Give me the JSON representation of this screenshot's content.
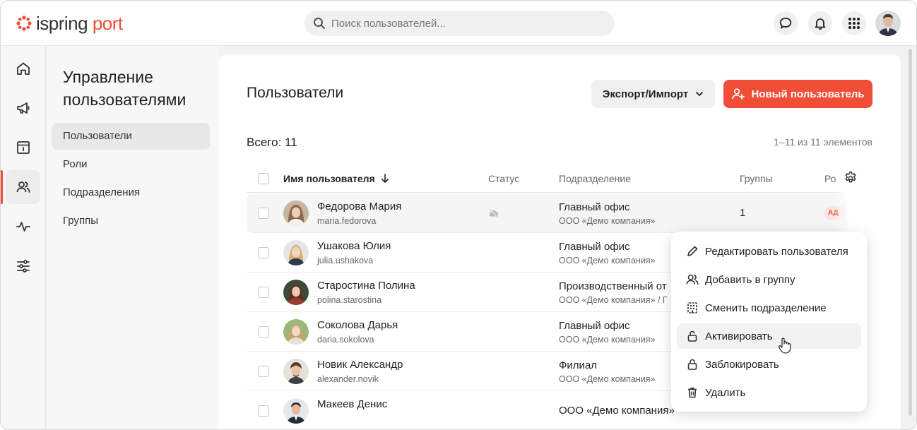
{
  "brand": {
    "logo_part1": "ispring",
    "logo_part2": "port",
    "accent": "#f04e37"
  },
  "header": {
    "search_placeholder": "Поиск пользователей..."
  },
  "sidenav": {
    "title": "Управление пользователями",
    "items": [
      {
        "label": "Пользователи",
        "active": true
      },
      {
        "label": "Роли"
      },
      {
        "label": "Подразделения"
      },
      {
        "label": "Группы"
      }
    ]
  },
  "main": {
    "title": "Пользователи",
    "export_label": "Экспорт/Импорт",
    "new_user_label": "Новый пользователь",
    "total": "Всего: 11",
    "pager": "1–11 из 11 элементов",
    "columns": {
      "name": "Имя пользователя",
      "status": "Статус",
      "dept": "Подразделение",
      "groups": "Группы",
      "roles": "Ро"
    },
    "rows": [
      {
        "name": "Федорова Мария",
        "login": "maria.fedorova",
        "dept": "Главный офис",
        "org": "ООО «Демо компания»",
        "groups": "1",
        "role": "АД"
      },
      {
        "name": "Ушакова Юлия",
        "login": "julia.ushakova",
        "dept": "Главный офис",
        "org": "ООО «Демо компания»"
      },
      {
        "name": "Старостина Полина",
        "login": "polina.starostina",
        "dept": "Производственный от",
        "org": "ООО «Демо компания» / Г"
      },
      {
        "name": "Соколова Дарья",
        "login": "daria.sokolova",
        "dept": "Главный офис",
        "org": "ООО «Демо компания»"
      },
      {
        "name": "Новик Александр",
        "login": "alexander.novik",
        "dept": "Филиал",
        "org": "ООО «Демо компания»"
      },
      {
        "name": "Макеев Денис",
        "login": "",
        "dept": "ООО «Демо компания»",
        "org": ""
      }
    ]
  },
  "menu": {
    "items": [
      {
        "label": "Редактировать пользователя",
        "icon": "pencil-icon"
      },
      {
        "label": "Добавить в группу",
        "icon": "users-icon"
      },
      {
        "label": "Сменить подразделение",
        "icon": "building-icon"
      },
      {
        "label": "Активировать",
        "icon": "unlock-icon"
      },
      {
        "label": "Заблокировать",
        "icon": "lock-icon"
      },
      {
        "label": "Удалить",
        "icon": "trash-icon"
      }
    ]
  }
}
